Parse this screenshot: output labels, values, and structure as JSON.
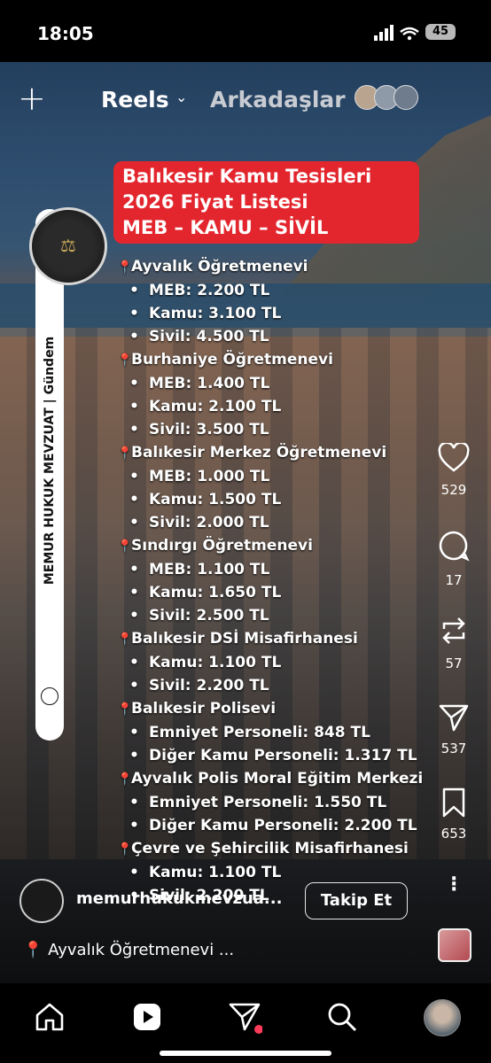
{
  "status_bar": {
    "time": "18:05",
    "battery": "45"
  },
  "top_nav": {
    "create_label": "+",
    "reels_label": "Reels",
    "friends_label": "Arkadaşlar"
  },
  "overlay": {
    "title_lines": [
      "Balıkesir Kamu Tesisleri",
      "2026 Fiyat Listesi",
      "MEB – KAMU – SİVİL"
    ],
    "sections": [
      {
        "name": "Ayvalık Öğretmenevi",
        "items": [
          "MEB: 2.200 TL",
          "Kamu: 3.100 TL",
          "Sivil: 4.500 TL"
        ]
      },
      {
        "name": "Burhaniye Öğretmenevi",
        "items": [
          "MEB: 1.400 TL",
          "Kamu: 2.100 TL",
          "Sivil: 3.500 TL"
        ]
      },
      {
        "name": "Balıkesir Merkez Öğretmenevi",
        "items": [
          "MEB: 1.000 TL",
          "Kamu: 1.500 TL",
          "Sivil: 2.000 TL"
        ]
      },
      {
        "name": "Sındırgı Öğretmenevi",
        "items": [
          "MEB: 1.100 TL",
          "Kamu: 1.650 TL",
          "Sivil: 2.500 TL"
        ]
      },
      {
        "name": "Balıkesir DSİ Misafirhanesi",
        "items": [
          "Kamu: 1.100 TL",
          "Sivil: 2.200 TL"
        ]
      },
      {
        "name": "Balıkesir Polisevi",
        "items": [
          "Emniyet Personeli: 848 TL",
          "Diğer Kamu Personeli: 1.317 TL"
        ]
      },
      {
        "name": "Ayvalık Polis Moral Eğitim Merkezi",
        "items": [
          "Emniyet Personeli: 1.550 TL",
          "Diğer Kamu Personeli: 2.200 TL"
        ]
      },
      {
        "name": "Çevre ve Şehircilik Misafirhanesi",
        "items": [
          "Kamu: 1.100 TL",
          "Sivil: 2.200 TL"
        ]
      }
    ],
    "side_label": "MEMUR HUKUK MEVZUAT  |  Gündem"
  },
  "actions": {
    "likes": "529",
    "comments": "17",
    "reposts": "57",
    "shares": "537",
    "saves": "653"
  },
  "post": {
    "username": "memurhukukmevzua...",
    "follow_label": "Takip Et",
    "location": "Ayvalık Öğretmenevi ..."
  },
  "icons": {
    "like": "heart-icon",
    "comment": "comment-icon",
    "repost": "repost-icon",
    "share": "send-icon",
    "save": "bookmark-icon",
    "more": "more-icon",
    "home": "home-icon",
    "reels": "reels-icon",
    "messages": "messages-icon",
    "search": "search-icon",
    "profile": "profile-avatar"
  },
  "colors": {
    "accent_red": "#e3262e",
    "notification_dot": "#ff3b5c"
  }
}
